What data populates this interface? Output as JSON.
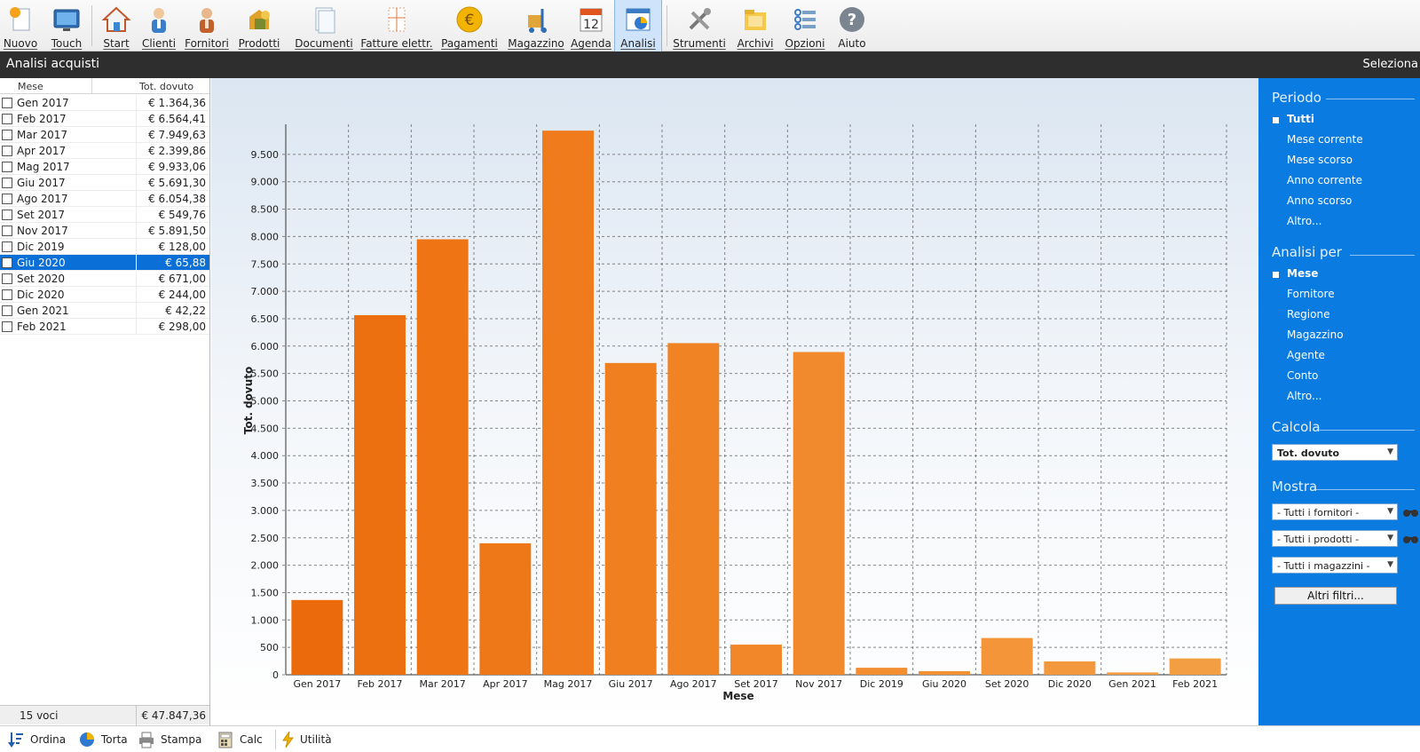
{
  "toolbar": {
    "items": [
      {
        "label": "Nuovo",
        "icon": "new-icon"
      },
      {
        "label": "Touch",
        "icon": "touch-icon"
      },
      {
        "label": "Start",
        "icon": "home-icon"
      },
      {
        "label": "Clienti",
        "icon": "clients-icon"
      },
      {
        "label": "Fornitori",
        "icon": "suppliers-icon"
      },
      {
        "label": "Prodotti",
        "icon": "products-icon"
      },
      {
        "label": "Documenti",
        "icon": "documents-icon"
      },
      {
        "label": "Fatture elettr.",
        "icon": "einvoice-icon"
      },
      {
        "label": "Pagamenti",
        "icon": "payments-icon"
      },
      {
        "label": "Magazzino",
        "icon": "warehouse-icon"
      },
      {
        "label": "Agenda",
        "icon": "calendar-icon",
        "badge": "12"
      },
      {
        "label": "Analisi",
        "icon": "analysis-icon",
        "active": true
      },
      {
        "label": "Strumenti",
        "icon": "tools-icon"
      },
      {
        "label": "Archivi",
        "icon": "archives-icon"
      },
      {
        "label": "Opzioni",
        "icon": "options-icon"
      },
      {
        "label": "Aiuto",
        "icon": "help-icon"
      }
    ]
  },
  "header": {
    "title": "Analisi acquisti",
    "right_action": "Seleziona"
  },
  "list": {
    "col_month": "Mese",
    "col_total": "Tot. dovuto",
    "rows": [
      {
        "month": "Gen 2017",
        "total": "€ 1.364,36"
      },
      {
        "month": "Feb 2017",
        "total": "€ 6.564,41"
      },
      {
        "month": "Mar 2017",
        "total": "€ 7.949,63"
      },
      {
        "month": "Apr 2017",
        "total": "€ 2.399,86"
      },
      {
        "month": "Mag 2017",
        "total": "€ 9.933,06"
      },
      {
        "month": "Giu 2017",
        "total": "€ 5.691,30"
      },
      {
        "month": "Ago 2017",
        "total": "€ 6.054,38"
      },
      {
        "month": "Set 2017",
        "total": "€ 549,76"
      },
      {
        "month": "Nov 2017",
        "total": "€ 5.891,50"
      },
      {
        "month": "Dic 2019",
        "total": "€ 128,00"
      },
      {
        "month": "Giu 2020",
        "total": "€ 65,88",
        "selected": true
      },
      {
        "month": "Set 2020",
        "total": "€ 671,00"
      },
      {
        "month": "Dic 2020",
        "total": "€ 244,00"
      },
      {
        "month": "Gen 2021",
        "total": "€ 42,22"
      },
      {
        "month": "Feb 2021",
        "total": "€ 298,00"
      }
    ],
    "footer_count": "15 voci",
    "footer_total": "€ 47.847,36"
  },
  "chart_data": {
    "type": "bar",
    "categories": [
      "Gen 2017",
      "Feb 2017",
      "Mar 2017",
      "Apr 2017",
      "Mag 2017",
      "Giu 2017",
      "Ago 2017",
      "Set 2017",
      "Nov 2017",
      "Dic 2019",
      "Giu 2020",
      "Set 2020",
      "Dic 2020",
      "Gen 2021",
      "Feb 2021"
    ],
    "values": [
      1364.36,
      6564.41,
      7949.63,
      2399.86,
      9933.06,
      5691.3,
      6054.38,
      549.76,
      5891.5,
      128.0,
      65.88,
      671.0,
      244.0,
      42.22,
      298.0
    ],
    "xlabel": "Mese",
    "ylabel": "Tot. dovuto",
    "ylim": [
      0,
      10000
    ],
    "yticks": [
      0,
      500,
      1000,
      1500,
      2000,
      2500,
      3000,
      3500,
      4000,
      4500,
      5000,
      5500,
      6000,
      6500,
      7000,
      7500,
      8000,
      8500,
      9000,
      9500
    ],
    "ytick_labels": [
      "0",
      "500",
      "1.000",
      "1.500",
      "2.000",
      "2.500",
      "3.000",
      "3.500",
      "4.000",
      "4.500",
      "5.000",
      "5.500",
      "6.000",
      "6.500",
      "7.000",
      "7.500",
      "8.000",
      "8.500",
      "9.000",
      "9.500"
    ],
    "grid": true,
    "bar_colors": [
      "#eb6a0c",
      "#ed7010",
      "#ee7414",
      "#ee7818",
      "#ef7b1c",
      "#f07f20",
      "#f08324",
      "#f18728",
      "#f18a2c",
      "#f28e30",
      "#f29134",
      "#f39538",
      "#f3983c",
      "#f49b40",
      "#f49e44"
    ]
  },
  "panel": {
    "period_title": "Periodo",
    "period_options": [
      "Tutti",
      "Mese corrente",
      "Mese scorso",
      "Anno corrente",
      "Anno scorso",
      "Altro..."
    ],
    "analysis_title": "Analisi per",
    "analysis_options": [
      "Mese",
      "Fornitore",
      "Regione",
      "Magazzino",
      "Agente",
      "Conto",
      "Altro..."
    ],
    "calc_title": "Calcola",
    "calc_value": "Tot. dovuto",
    "show_title": "Mostra",
    "filter_suppliers": "- Tutti i fornitori -",
    "filter_products": "- Tutti i prodotti -",
    "filter_warehouses": "- Tutti i magazzini -",
    "more_filters": "Altri filtri..."
  },
  "bottom": {
    "items": [
      {
        "label": "Ordina",
        "icon": "sort-icon"
      },
      {
        "label": "Torta",
        "icon": "pie-icon"
      },
      {
        "label": "Stampa",
        "icon": "print-icon"
      },
      {
        "label": "Calc",
        "icon": "calc-icon"
      },
      {
        "label": "Utilità",
        "icon": "utility-icon"
      }
    ]
  },
  "colors": {
    "accent": "#0a7be0",
    "selection": "#0a6fd6",
    "bar": "#ef7b1c",
    "header": "#2e2e2e"
  }
}
